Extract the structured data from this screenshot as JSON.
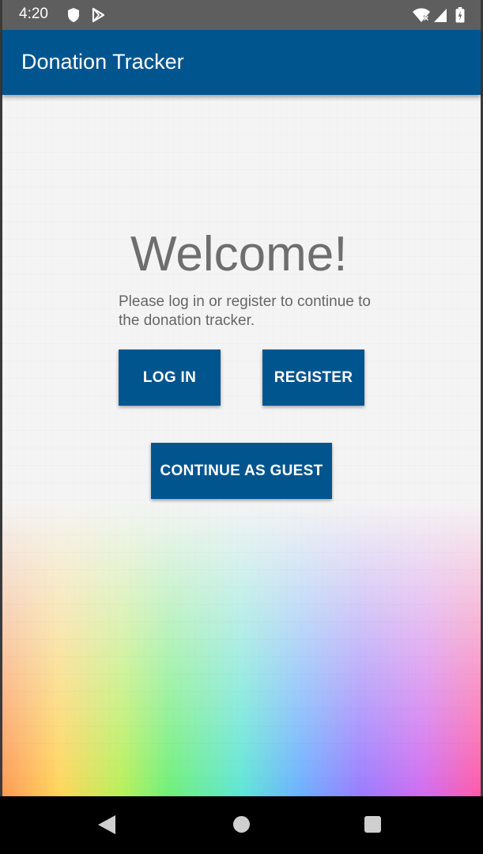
{
  "status_bar": {
    "time": "4:20",
    "icons": [
      "shield-icon",
      "play-store-icon",
      "wifi-icon",
      "signal-icon",
      "battery-icon"
    ]
  },
  "app_bar": {
    "title": "Donation Tracker",
    "color": "#00558f"
  },
  "main": {
    "welcome_title": "Welcome!",
    "welcome_text": "Please log in or register to continue to the donation tracker.",
    "buttons": {
      "login": "LOG IN",
      "register": "REGISTER",
      "guest": "CONTINUE AS GUEST"
    },
    "accent_color": "#00558f"
  },
  "nav_bar": {
    "icons": [
      "back-icon",
      "home-icon",
      "recents-icon"
    ]
  }
}
